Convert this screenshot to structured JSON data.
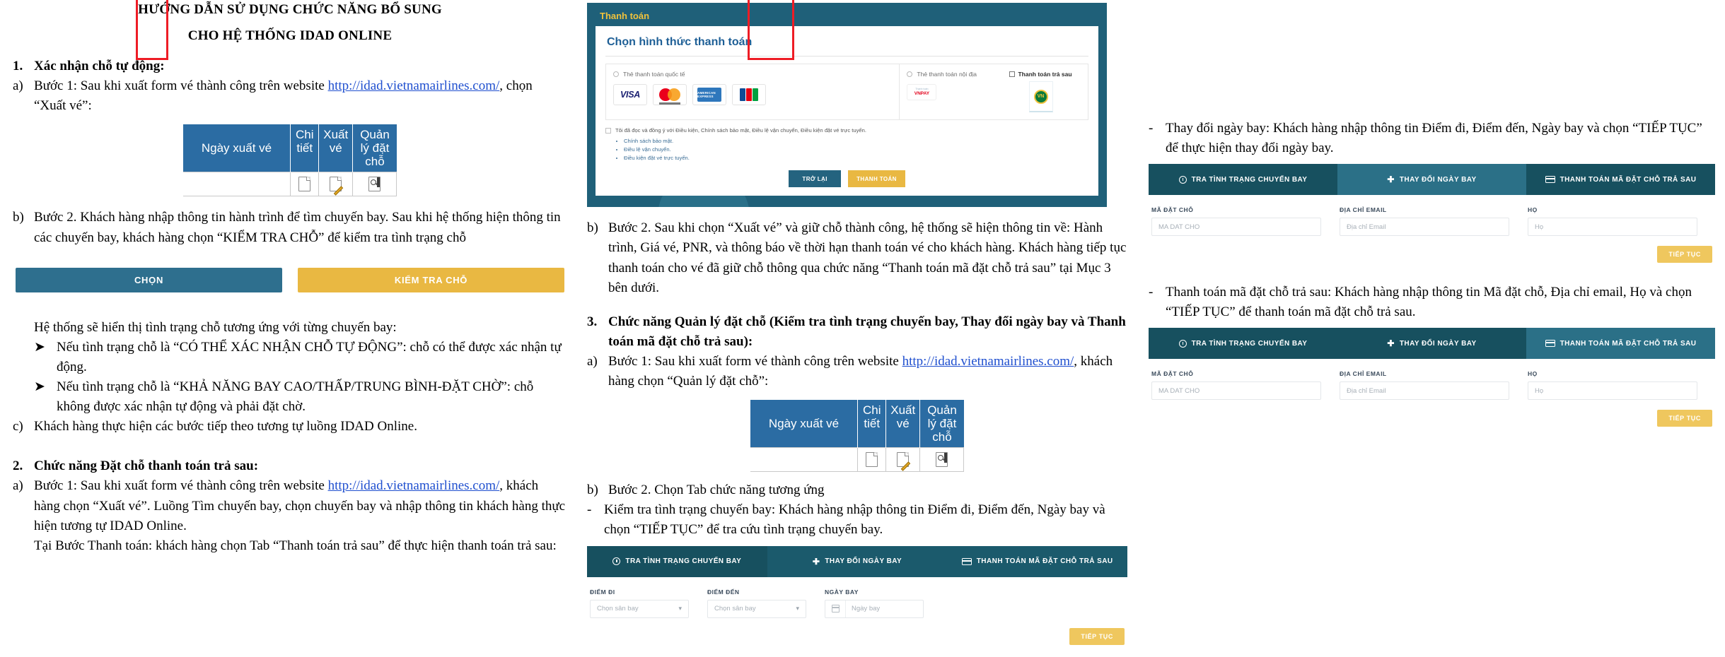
{
  "document": {
    "title_line1": "HƯỚNG DẪN SỬ DỤNG CHỨC NĂNG BỔ SUNG",
    "title_line2": "CHO HỆ THỐNG IDAD ONLINE"
  },
  "url": "http://idad.vietnamairlines.com/",
  "section1": {
    "num": "1.",
    "heading": "Xác nhận chỗ tự động:",
    "a": {
      "marker": "a)",
      "text_before": "Bước 1: Sau khi xuất form vé thành công trên website ",
      "text_after": ", chọn “Xuất vé”:"
    },
    "b": {
      "marker": "b)",
      "text": "Bước 2. Khách hàng nhập thông tin hành trình để tìm chuyến bay. Sau khi hệ thống hiện thông tin các chuyến bay, khách hàng chọn “KIỂM TRA CHỖ” để kiểm tra tình trạng chỗ"
    },
    "after_buttons": "Hệ thống sẽ hiển thị tình trạng chỗ tương ứng với từng chuyến bay:",
    "bullet1": "Nếu tình trạng chỗ là “CÓ THỂ XÁC NHẬN CHỖ TỰ ĐỘNG”: chỗ có thể được xác nhận tự động.",
    "bullet2": "Nếu tình trạng chỗ là “KHẢ NĂNG BAY CAO/THẤP/TRUNG BÌNH-ĐẶT CHỜ”: chỗ không được xác nhận tự động và phải đặt chờ.",
    "c": {
      "marker": "c)",
      "text": "Khách hàng thực hiện các bước tiếp theo tương tự luồng IDAD Online."
    }
  },
  "section2": {
    "num": "2.",
    "heading": "Chức năng Đặt chỗ thanh toán trả sau:",
    "a": {
      "marker": "a)",
      "line1_before": "Bước 1: Sau khi xuất form vé thành công trên website ",
      "line1_after": ",",
      "line2": "khách hàng chọn “Xuất vé”. Luồng Tìm chuyến bay, chọn chuyến bay và nhập thông tin khách hàng thực hiện tương tự IDAD Online.",
      "line3": "Tại Bước Thanh toán: khách hàng chọn Tab “Thanh toán trả sau” để thực hiện thanh toán trả sau:"
    },
    "b": {
      "marker": "b)",
      "text": "Bước 2. Sau khi chọn “Xuất vé” và giữ chỗ thành công, hệ thống sẽ hiện thông tin về: Hành trình, Giá vé, PNR, và thông báo về thời hạn thanh toán vé cho khách hàng. Khách hàng tiếp tục thanh toán cho vé đã giữ chỗ thông qua chức năng “Thanh toán mã đặt chỗ trả sau” tại Mục 3 bên dưới."
    }
  },
  "section3": {
    "num": "3.",
    "heading": "Chức năng Quản lý đặt chỗ (Kiểm tra tình trạng chuyến bay, Thay đổi ngày bay  và Thanh toán mã đặt chỗ trả sau):",
    "a": {
      "marker": "a)",
      "line1_before": "Bước 1: Sau khi xuất form vé thành công trên website ",
      "line1_after": ",",
      "line2": "khách hàng chọn “Quản lý đặt chỗ”:"
    },
    "b": {
      "marker": "b)",
      "text": "Bước 2. Chọn Tab chức năng tương ứng"
    },
    "bullet_check": "Kiểm tra tình trạng chuyến bay: Khách hàng nhập thông tin Điểm đi, Điểm đến, Ngày bay và chọn “TIẾP TỤC” để tra cứu tình trạng chuyến bay.",
    "bullet_change": "Thay đổi ngày bay: Khách hàng nhập thông tin Điểm đi, Điểm đến, Ngày bay và chọn “TIẾP TỤC” để thực hiện thay đổi ngày bay.",
    "bullet_pay": "Thanh toán mã đặt chỗ trả sau: Khách hàng nhập thông tin Mã đặt chỗ, Địa chỉ email, Họ và chọn “TIẾP TỤC” để thanh toán mã đặt chỗ trả sau."
  },
  "action_table": {
    "headers": [
      "Ngày xuất vé",
      "Chi tiết",
      "Xuất vé",
      "Quản lý đặt chỗ"
    ],
    "icons": [
      "detail-page-icon",
      "edit-pencil-icon",
      "booking-search-icon"
    ]
  },
  "buttons": {
    "choose": "CHỌN",
    "check_seat": "KIỂM TRA CHỖ"
  },
  "payment_screenshot": {
    "header": "Thanh toán",
    "card_title": "Chọn hình thức thanh toán",
    "option_international": "Thẻ thanh toán quốc tế",
    "option_domestic": "Thẻ thanh toán nội địa",
    "option_paylater": "Thanh toán trả sau",
    "cards_international": [
      "VISA",
      "mastercard",
      "AMERICAN EXPRESS",
      "JCB"
    ],
    "card_domestic": "VNPAY",
    "card_paylater": "VNPOST",
    "terms_line": "Tôi đã đọc và đồng ý với Điều kiện, Chính sách bảo mật, Điều lệ vận chuyển, Điều kiện đặt vé trực tuyến.",
    "terms_links": [
      "Chính sách bảo mật.",
      "Điều lệ vận chuyển.",
      "Điều kiện đặt vé trực tuyến."
    ],
    "btn_back": "TRỞ LẠI",
    "btn_pay": "THANH TOÁN"
  },
  "widget_tabs": {
    "tab1": "TRA TÌNH TRẠNG CHUYẾN BAY",
    "tab2": "THAY ĐỔI NGÀY BAY",
    "tab3": "THANH TOÁN MÃ ĐẶT CHỖ TRẢ SAU"
  },
  "form_flight": {
    "label_from": "ĐIỂM ĐI",
    "label_to": "ĐIỂM ĐẾN",
    "label_date": "NGÀY BAY",
    "placeholder_from": "Chọn sân bay",
    "placeholder_to": "Chọn sân bay",
    "placeholder_date": "Ngày bay",
    "continue": "TIẾP TỤC"
  },
  "form_booking": {
    "label_code": "MÃ ĐẶT CHỖ",
    "label_email": "ĐỊA CHỈ EMAIL",
    "label_lastname": "HỌ",
    "placeholder_code": "MA DAT CHO",
    "placeholder_email": "Địa chỉ Email",
    "placeholder_lastname": "Họ",
    "continue": "TIẾP TỤC"
  },
  "colors": {
    "table_header_blue": "#2b6ca3",
    "btn_teal": "#2e6f8e",
    "btn_gold": "#e9b842",
    "highlight_red": "#ee1c25",
    "tab_dark": "#17505f",
    "tab_light": "#2b7087",
    "payment_bg": "#1f6079",
    "link_blue": "#1f4fcf"
  }
}
